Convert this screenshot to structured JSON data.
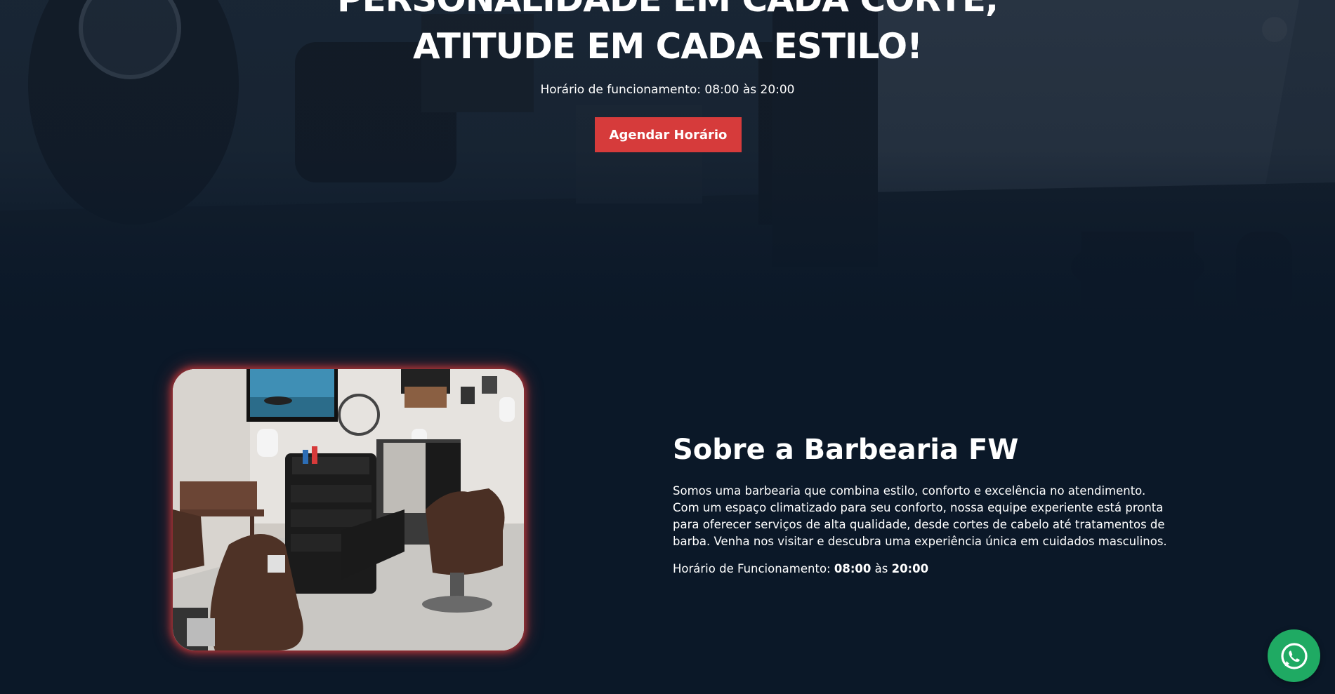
{
  "hero": {
    "title_line1": "PERSONALIDADE EM CADA CORTE,",
    "title_line2": "ATITUDE EM CADA ESTILO!",
    "hours_text": "Horário de funcionamento: 08:00 às 20:00",
    "cta_label": "Agendar Horário",
    "background_image": "barbershop-interior-photo"
  },
  "about": {
    "title": "Sobre a Barbearia FW",
    "description": "Somos uma barbearia que combina estilo, conforto e excelência no atendimento. Com um espaço climatizado para seu conforto, nossa equipe experiente está pronta para oferecer serviços de alta qualidade, desde cortes de cabelo até tratamentos de barba. Venha nos visitar e descubra uma experiência única em cuidados masculinos.",
    "hours_label": "Horário de Funcionamento: ",
    "hours_open": "08:00",
    "hours_sep": " às ",
    "hours_close": "20:00",
    "image": "barbershop-chairs-photo"
  },
  "whatsapp": {
    "icon": "whatsapp-icon"
  },
  "colors": {
    "background": "#0b1828",
    "accent": "#d63b3b",
    "whatsapp": "#1faa63",
    "text": "#ffffff"
  }
}
